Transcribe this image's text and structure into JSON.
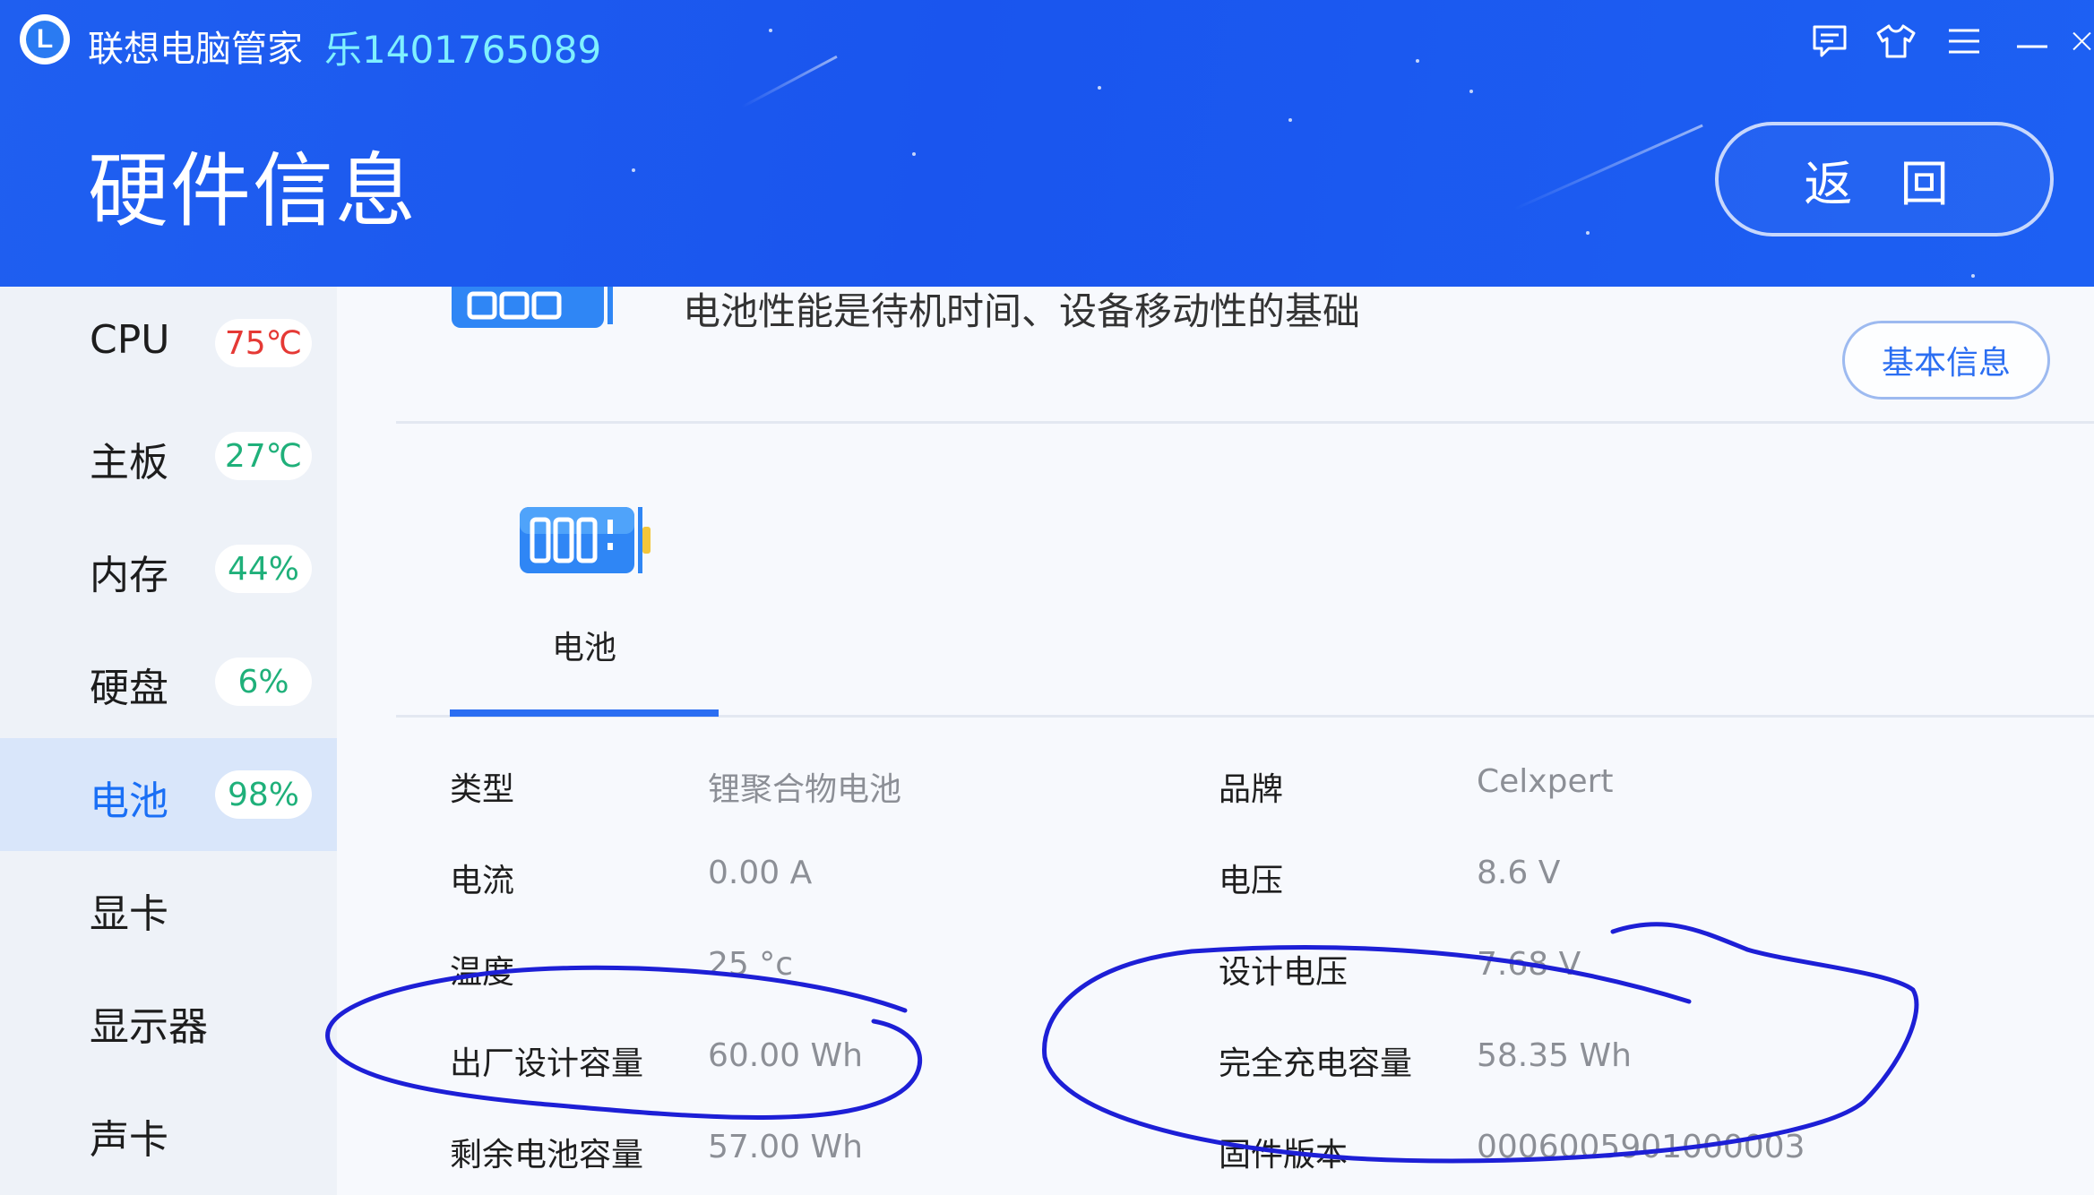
{
  "header": {
    "app_title": "联想电脑管家",
    "account": "乐1401765089",
    "page_title": "硬件信息",
    "back_label": "返 回",
    "window_icons": [
      "feedback-icon",
      "skin-icon",
      "menu-icon",
      "minimize-icon",
      "close-icon"
    ]
  },
  "sidebar": {
    "items": [
      {
        "label": "CPU",
        "badge": "75℃",
        "badge_color": "#e53935"
      },
      {
        "label": "主板",
        "badge": "27℃",
        "badge_color": "#1fb07a"
      },
      {
        "label": "内存",
        "badge": "44%",
        "badge_color": "#1fb07a"
      },
      {
        "label": "硬盘",
        "badge": "6%",
        "badge_color": "#1fb07a"
      },
      {
        "label": "电池",
        "badge": "98%",
        "badge_color": "#1fb07a",
        "active": true
      },
      {
        "label": "显卡"
      },
      {
        "label": "显示器"
      },
      {
        "label": "声卡"
      }
    ]
  },
  "main": {
    "banner_text": "电池性能是待机时间、设备移动性的基础",
    "basic_info_label": "基本信息",
    "tab_label": "电池",
    "rows": [
      {
        "label_left": "类型",
        "value_left": "锂聚合物电池",
        "label_right": "品牌",
        "value_right": "Celxpert"
      },
      {
        "label_left": "电流",
        "value_left": "0.00 A",
        "label_right": "电压",
        "value_right": "8.6 V"
      },
      {
        "label_left": "温度",
        "value_left": "25 °c",
        "label_right": "设计电压",
        "value_right": "7.68 V"
      },
      {
        "label_left": "出厂设计容量",
        "value_left": "60.00 Wh",
        "label_right": "完全充电容量",
        "value_right": "58.35 Wh"
      },
      {
        "label_left": "剩余电池容量",
        "value_left": "57.00 Wh",
        "label_right": "固件版本",
        "value_right": "0006005901000003"
      }
    ]
  },
  "colors": {
    "header_blue": "#1a55ee",
    "accent_blue": "#2b6ef2",
    "annotation_ink": "#1d1fd6",
    "account_cyan": "#7ff0ff"
  }
}
